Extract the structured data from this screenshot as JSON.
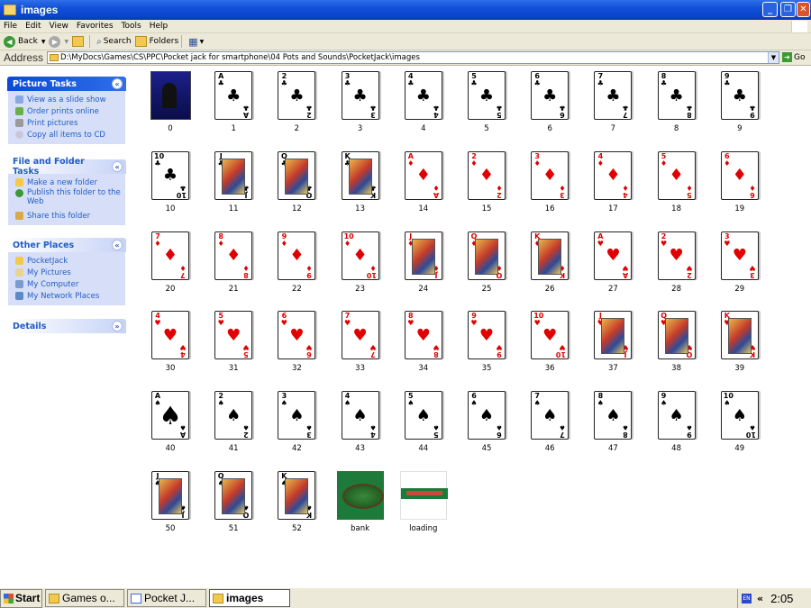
{
  "window": {
    "title": "images"
  },
  "menu": [
    "File",
    "Edit",
    "View",
    "Favorites",
    "Tools",
    "Help"
  ],
  "toolbar": {
    "back": "Back",
    "search": "Search",
    "folders": "Folders"
  },
  "address": {
    "label": "Address",
    "path": "D:\\MyDocs\\Games\\CS\\PPC\\Pocket jack for smartphone\\04 Pots and Sounds\\PocketJack\\images",
    "go": "Go"
  },
  "sidebar": {
    "picture_tasks": {
      "title": "Picture Tasks",
      "items": [
        "View as a slide show",
        "Order prints online",
        "Print pictures",
        "Copy all items to CD"
      ]
    },
    "file_folder_tasks": {
      "title": "File and Folder Tasks",
      "items": [
        "Make a new folder",
        "Publish this folder to the Web",
        "Share this folder"
      ]
    },
    "other_places": {
      "title": "Other Places",
      "items": [
        "PocketJack",
        "My Pictures",
        "My Computer",
        "My Network Places"
      ]
    },
    "details": {
      "title": "Details"
    }
  },
  "files": [
    {
      "label": "0",
      "kind": "img0"
    },
    {
      "label": "1",
      "kind": "card",
      "rank": "A",
      "suit": "♣",
      "color": "blk"
    },
    {
      "label": "2",
      "kind": "card",
      "rank": "2",
      "suit": "♣",
      "color": "blk"
    },
    {
      "label": "3",
      "kind": "card",
      "rank": "3",
      "suit": "♣",
      "color": "blk"
    },
    {
      "label": "4",
      "kind": "card",
      "rank": "4",
      "suit": "♣",
      "color": "blk"
    },
    {
      "label": "5",
      "kind": "card",
      "rank": "5",
      "suit": "♣",
      "color": "blk"
    },
    {
      "label": "6",
      "kind": "card",
      "rank": "6",
      "suit": "♣",
      "color": "blk"
    },
    {
      "label": "7",
      "kind": "card",
      "rank": "7",
      "suit": "♣",
      "color": "blk"
    },
    {
      "label": "8",
      "kind": "card",
      "rank": "8",
      "suit": "♣",
      "color": "blk"
    },
    {
      "label": "9",
      "kind": "card",
      "rank": "9",
      "suit": "♣",
      "color": "blk"
    },
    {
      "label": "10",
      "kind": "card",
      "rank": "10",
      "suit": "♣",
      "color": "blk"
    },
    {
      "label": "11",
      "kind": "face",
      "rank": "J",
      "suit": "♣",
      "color": "blk"
    },
    {
      "label": "12",
      "kind": "face",
      "rank": "Q",
      "suit": "♣",
      "color": "blk"
    },
    {
      "label": "13",
      "kind": "face",
      "rank": "K",
      "suit": "♣",
      "color": "blk"
    },
    {
      "label": "14",
      "kind": "card",
      "rank": "A",
      "suit": "♦",
      "color": "red"
    },
    {
      "label": "15",
      "kind": "card",
      "rank": "2",
      "suit": "♦",
      "color": "red"
    },
    {
      "label": "16",
      "kind": "card",
      "rank": "3",
      "suit": "♦",
      "color": "red"
    },
    {
      "label": "17",
      "kind": "card",
      "rank": "4",
      "suit": "♦",
      "color": "red"
    },
    {
      "label": "18",
      "kind": "card",
      "rank": "5",
      "suit": "♦",
      "color": "red"
    },
    {
      "label": "19",
      "kind": "card",
      "rank": "6",
      "suit": "♦",
      "color": "red"
    },
    {
      "label": "20",
      "kind": "card",
      "rank": "7",
      "suit": "♦",
      "color": "red"
    },
    {
      "label": "21",
      "kind": "card",
      "rank": "8",
      "suit": "♦",
      "color": "red"
    },
    {
      "label": "22",
      "kind": "card",
      "rank": "9",
      "suit": "♦",
      "color": "red"
    },
    {
      "label": "23",
      "kind": "card",
      "rank": "10",
      "suit": "♦",
      "color": "red"
    },
    {
      "label": "24",
      "kind": "face",
      "rank": "J",
      "suit": "♦",
      "color": "red"
    },
    {
      "label": "25",
      "kind": "face",
      "rank": "Q",
      "suit": "♦",
      "color": "red"
    },
    {
      "label": "26",
      "kind": "face",
      "rank": "K",
      "suit": "♦",
      "color": "red"
    },
    {
      "label": "27",
      "kind": "card",
      "rank": "A",
      "suit": "♥",
      "color": "red"
    },
    {
      "label": "28",
      "kind": "card",
      "rank": "2",
      "suit": "♥",
      "color": "red"
    },
    {
      "label": "29",
      "kind": "card",
      "rank": "3",
      "suit": "♥",
      "color": "red"
    },
    {
      "label": "30",
      "kind": "card",
      "rank": "4",
      "suit": "♥",
      "color": "red"
    },
    {
      "label": "31",
      "kind": "card",
      "rank": "5",
      "suit": "♥",
      "color": "red"
    },
    {
      "label": "32",
      "kind": "card",
      "rank": "6",
      "suit": "♥",
      "color": "red"
    },
    {
      "label": "33",
      "kind": "card",
      "rank": "7",
      "suit": "♥",
      "color": "red"
    },
    {
      "label": "34",
      "kind": "card",
      "rank": "8",
      "suit": "♥",
      "color": "red"
    },
    {
      "label": "35",
      "kind": "card",
      "rank": "9",
      "suit": "♥",
      "color": "red"
    },
    {
      "label": "36",
      "kind": "card",
      "rank": "10",
      "suit": "♥",
      "color": "red"
    },
    {
      "label": "37",
      "kind": "face",
      "rank": "J",
      "suit": "♥",
      "color": "red"
    },
    {
      "label": "38",
      "kind": "face",
      "rank": "Q",
      "suit": "♥",
      "color": "red"
    },
    {
      "label": "39",
      "kind": "face",
      "rank": "K",
      "suit": "♥",
      "color": "red"
    },
    {
      "label": "40",
      "kind": "card",
      "rank": "A",
      "suit": "♠",
      "color": "blk"
    },
    {
      "label": "41",
      "kind": "card",
      "rank": "2",
      "suit": "♠",
      "color": "blk"
    },
    {
      "label": "42",
      "kind": "card",
      "rank": "3",
      "suit": "♠",
      "color": "blk"
    },
    {
      "label": "43",
      "kind": "card",
      "rank": "4",
      "suit": "♠",
      "color": "blk"
    },
    {
      "label": "44",
      "kind": "card",
      "rank": "5",
      "suit": "♠",
      "color": "blk"
    },
    {
      "label": "45",
      "kind": "card",
      "rank": "6",
      "suit": "♠",
      "color": "blk"
    },
    {
      "label": "46",
      "kind": "card",
      "rank": "7",
      "suit": "♠",
      "color": "blk"
    },
    {
      "label": "47",
      "kind": "card",
      "rank": "8",
      "suit": "♠",
      "color": "blk"
    },
    {
      "label": "48",
      "kind": "card",
      "rank": "9",
      "suit": "♠",
      "color": "blk"
    },
    {
      "label": "49",
      "kind": "card",
      "rank": "10",
      "suit": "♠",
      "color": "blk"
    },
    {
      "label": "50",
      "kind": "face",
      "rank": "J",
      "suit": "♠",
      "color": "blk"
    },
    {
      "label": "51",
      "kind": "face",
      "rank": "Q",
      "suit": "♠",
      "color": "blk"
    },
    {
      "label": "52",
      "kind": "face",
      "rank": "K",
      "suit": "♠",
      "color": "blk"
    },
    {
      "label": "bank",
      "kind": "bank"
    },
    {
      "label": "loading",
      "kind": "loading"
    }
  ],
  "taskbar": {
    "start": "Start",
    "buttons": [
      {
        "label": "Games o...",
        "icon": "folder-icon",
        "active": false
      },
      {
        "label": "Pocket J...",
        "icon": "window-icon",
        "active": false
      },
      {
        "label": "images",
        "icon": "folder-icon",
        "active": true
      }
    ],
    "language": "EN",
    "clock": "2:05"
  }
}
